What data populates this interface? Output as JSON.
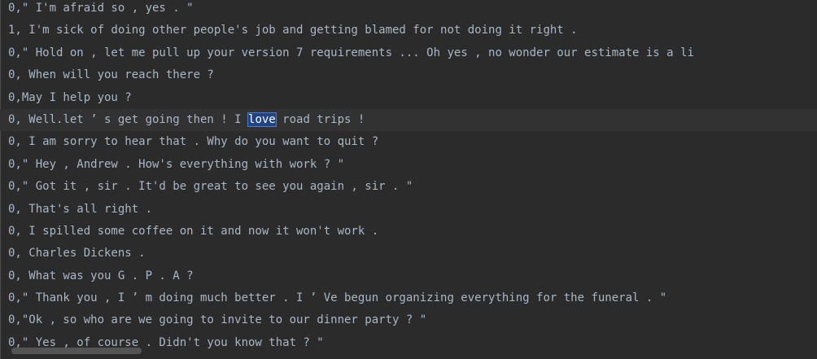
{
  "editor": {
    "lines": [
      "0,\" I'm afraid so , yes . \"",
      "1, I'm sick of doing other people's job and getting blamed for not doing it right .",
      "0,\" Hold on , let me pull up your version 7 requirements ... Oh yes , no wonder our estimate is a li",
      "0, When will you reach there ?",
      "0,May I help you ?",
      "0, Well.let ’ s get going then ! I love road trips !",
      "0, I am sorry to hear that . Why do you want to quit ?",
      "0,\" Hey , Andrew . How's everything with work ? \"",
      "0,\" Got it , sir . It'd be great to see you again , sir . \"",
      "0, That's all right .",
      "0, I spilled some coffee on it and now it won't work .",
      "0, Charles Dickens .",
      "0, What was you G . P . A ?",
      "0,\" Thank you , I ’ m doing much better . I ’ Ve begun organizing everything for the funeral . \"",
      "0,\"Ok , so who are we going to invite to our dinner party ? \"",
      "0,\" Yes , of course . Didn't you know that ? \""
    ],
    "current_line": {
      "before": "0, Well.let ’ s get going then ! I ",
      "selected": "love",
      "after": " road trips !"
    },
    "colors": {
      "background": "#2b2b2b",
      "text": "#a9b7c6",
      "current_line": "#323232",
      "selection": "#214283"
    }
  }
}
